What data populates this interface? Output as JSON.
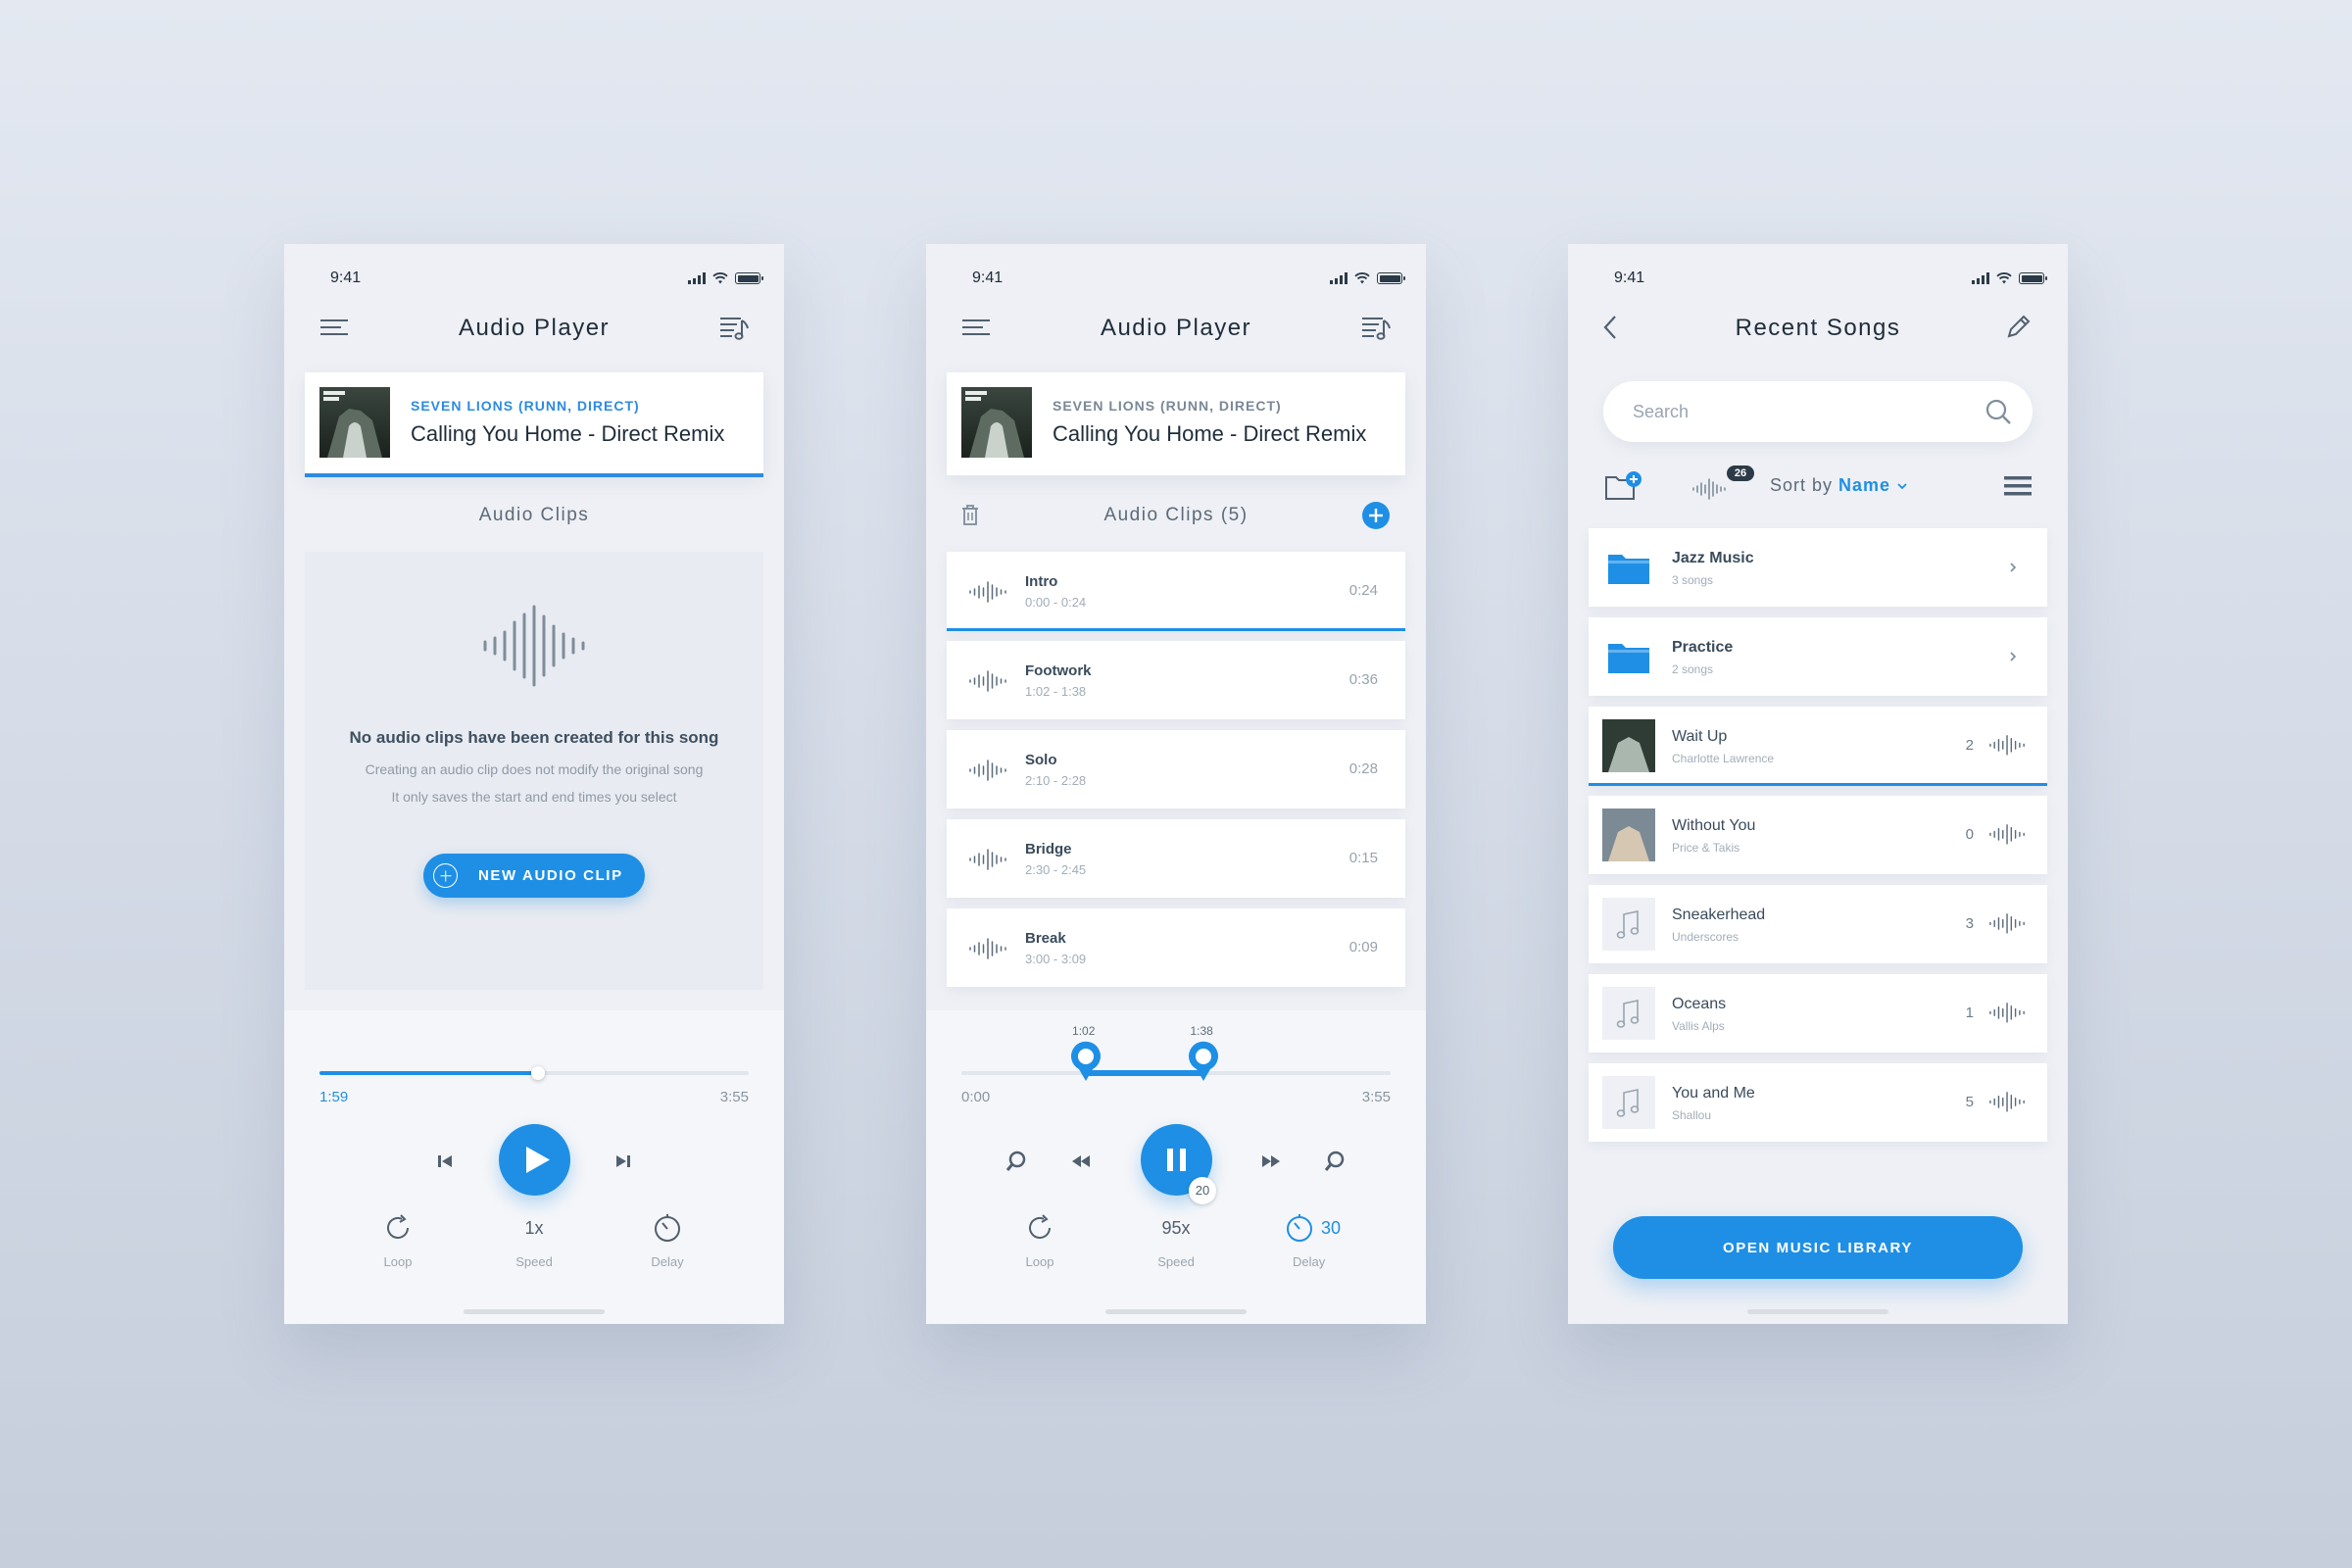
{
  "colors": {
    "accent": "#1f8fe5",
    "background": "#dfe4ed",
    "card": "#ffffff",
    "text": "#1f2d3a"
  },
  "status_bar": {
    "time": "9:41"
  },
  "now_playing": {
    "artist": "SEVEN LIONS (RUNN, DIRECT)",
    "title": "Calling You Home - Direct Remix",
    "art_icon": "album-art-seven-lions"
  },
  "screen_a": {
    "title": "Audio Player",
    "section_title": "Audio Clips",
    "empty": {
      "title": "No audio clips have been created for this song",
      "line1": "Creating an audio clip does not modify the original song",
      "line2": "It only saves the start and end times you select",
      "button": "NEW AUDIO CLIP"
    },
    "player": {
      "current_time": "1:59",
      "total_time": "3:55",
      "progress": 0.51,
      "options": [
        {
          "value": "",
          "label": "Loop",
          "icon": "loop-icon"
        },
        {
          "value": "1x",
          "label": "Speed",
          "icon": ""
        },
        {
          "value": "",
          "label": "Delay",
          "icon": "timer-icon"
        }
      ]
    }
  },
  "screen_b": {
    "title": "Audio Player",
    "section_title": "Audio Clips (5)",
    "clips": [
      {
        "name": "Intro",
        "range": "0:00 - 0:24",
        "duration": "0:24"
      },
      {
        "name": "Footwork",
        "range": "1:02 - 1:38",
        "duration": "0:36"
      },
      {
        "name": "Solo",
        "range": "2:10 - 2:28",
        "duration": "0:28"
      },
      {
        "name": "Bridge",
        "range": "2:30 - 2:45",
        "duration": "0:15"
      },
      {
        "name": "Break",
        "range": "3:00 - 3:09",
        "duration": "0:09"
      }
    ],
    "player": {
      "start_marker": "1:02",
      "end_marker": "1:38",
      "start_fraction": 0.29,
      "end_fraction": 0.565,
      "current_time": "0:00",
      "total_time": "3:55",
      "skip_badge": "20",
      "options": [
        {
          "value": "",
          "label": "Loop",
          "icon": "loop-icon"
        },
        {
          "value": "95x",
          "label": "Speed",
          "icon": ""
        },
        {
          "value": "30",
          "label": "Delay",
          "icon": "timer-icon"
        }
      ]
    }
  },
  "screen_c": {
    "title": "Recent Songs",
    "search_placeholder": "Search",
    "clip_count_badge": "26",
    "sort_prefix": "Sort by",
    "sort_value": "Name",
    "folders": [
      {
        "name": "Jazz Music",
        "sub": "3 songs"
      },
      {
        "name": "Practice",
        "sub": "2 songs"
      }
    ],
    "songs": [
      {
        "name": "Wait Up",
        "artist": "Charlotte Lawrence",
        "count": "2"
      },
      {
        "name": "Without You",
        "artist": "Price & Takis",
        "count": "0"
      },
      {
        "name": "Sneakerhead",
        "artist": "Underscores",
        "count": "3"
      },
      {
        "name": "Oceans",
        "artist": "Vallis Alps",
        "count": "1"
      },
      {
        "name": "You and Me",
        "artist": "Shallou",
        "count": "5"
      }
    ],
    "button": "OPEN MUSIC LIBRARY"
  }
}
